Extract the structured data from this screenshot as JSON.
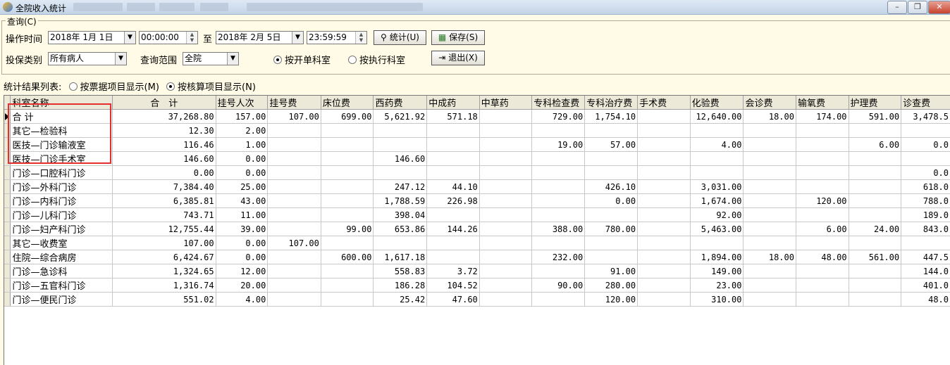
{
  "window": {
    "title": "全院收入统计",
    "minimize": "–",
    "restore": "❐",
    "close": "✕"
  },
  "query": {
    "group_label": "查询(C)",
    "op_time_label": "操作时间",
    "start_date": "2018年  1月 1日",
    "start_time": "00:00:00",
    "to_label": "至",
    "end_date": "2018年  2月 5日",
    "end_time": "23:59:59",
    "stat_button": "统计(U)",
    "save_button": "保存(S)",
    "insure_label": "投保类别",
    "insure_value": "所有病人",
    "scope_label": "查询范围",
    "scope_value": "全院",
    "radio_open_dept": "按开单科室",
    "radio_exec_dept": "按执行科室",
    "exit_button": "退出(X)"
  },
  "result_list": {
    "label": "统计结果列表:",
    "radio_bill": "按票据项目显示(M)",
    "radio_account": "按核算项目显示(N)"
  },
  "table": {
    "columns": [
      "科室名称",
      "合　计",
      "挂号人次",
      "挂号费",
      "床位费",
      "西药费",
      "中成药",
      "中草药",
      "专科检查费",
      "专科治疗费",
      "手术费",
      "化验费",
      "会诊费",
      "输氧费",
      "护理费",
      "诊查费"
    ],
    "rows": [
      [
        "合 计",
        "37,268.80",
        "157.00",
        "107.00",
        "699.00",
        "5,621.92",
        "571.18",
        "",
        "729.00",
        "1,754.10",
        "",
        "12,640.00",
        "18.00",
        "174.00",
        "591.00",
        "3,478.5"
      ],
      [
        "其它—检验科",
        "12.30",
        "2.00",
        "",
        "",
        "",
        "",
        "",
        "",
        "",
        "",
        "",
        "",
        "",
        "",
        ""
      ],
      [
        "医技—门诊输液室",
        "116.46",
        "1.00",
        "",
        "",
        "",
        "",
        "",
        "19.00",
        "57.00",
        "",
        "4.00",
        "",
        "",
        "6.00",
        "0.0"
      ],
      [
        "医技—门诊手术室",
        "146.60",
        "0.00",
        "",
        "",
        "146.60",
        "",
        "",
        "",
        "",
        "",
        "",
        "",
        "",
        "",
        ""
      ],
      [
        "门诊—口腔科门诊",
        "0.00",
        "0.00",
        "",
        "",
        "",
        "",
        "",
        "",
        "",
        "",
        "",
        "",
        "",
        "",
        "0.0"
      ],
      [
        "门诊—外科门诊",
        "7,384.40",
        "25.00",
        "",
        "",
        "247.12",
        "44.10",
        "",
        "",
        "426.10",
        "",
        "3,031.00",
        "",
        "",
        "",
        "618.0"
      ],
      [
        "门诊—内科门诊",
        "6,385.81",
        "43.00",
        "",
        "",
        "1,788.59",
        "226.98",
        "",
        "",
        "0.00",
        "",
        "1,674.00",
        "",
        "120.00",
        "",
        "788.0"
      ],
      [
        "门诊—儿科门诊",
        "743.71",
        "11.00",
        "",
        "",
        "398.04",
        "",
        "",
        "",
        "",
        "",
        "92.00",
        "",
        "",
        "",
        "189.0"
      ],
      [
        "门诊—妇产科门诊",
        "12,755.44",
        "39.00",
        "",
        "99.00",
        "653.86",
        "144.26",
        "",
        "388.00",
        "780.00",
        "",
        "5,463.00",
        "",
        "6.00",
        "24.00",
        "843.0"
      ],
      [
        "其它—收费室",
        "107.00",
        "0.00",
        "107.00",
        "",
        "",
        "",
        "",
        "",
        "",
        "",
        "",
        "",
        "",
        "",
        ""
      ],
      [
        "住院—综合病房",
        "6,424.67",
        "0.00",
        "",
        "600.00",
        "1,617.18",
        "",
        "",
        "232.00",
        "",
        "",
        "1,894.00",
        "18.00",
        "48.00",
        "561.00",
        "447.5"
      ],
      [
        "门诊—急诊科",
        "1,324.65",
        "12.00",
        "",
        "",
        "558.83",
        "3.72",
        "",
        "",
        "91.00",
        "",
        "149.00",
        "",
        "",
        "",
        "144.0"
      ],
      [
        "门诊—五官科门诊",
        "1,316.74",
        "20.00",
        "",
        "",
        "186.28",
        "104.52",
        "",
        "90.00",
        "280.00",
        "",
        "23.00",
        "",
        "",
        "",
        "401.0"
      ],
      [
        "门诊—便民门诊",
        "551.02",
        "4.00",
        "",
        "",
        "25.42",
        "47.60",
        "",
        "",
        "120.00",
        "",
        "310.00",
        "",
        "",
        "",
        "48.0"
      ]
    ]
  }
}
